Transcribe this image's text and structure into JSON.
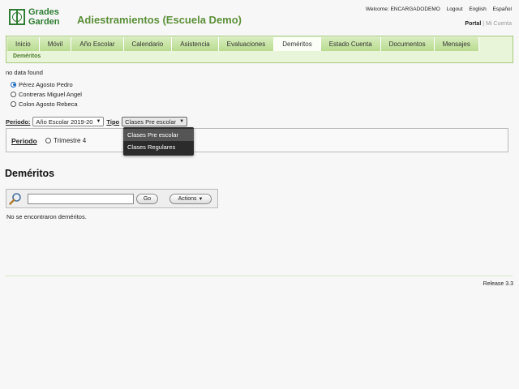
{
  "logo": {
    "line1": "Grades",
    "line2": "Garden"
  },
  "app_title": "Adiestramientos (Escuela Demo)",
  "top_links": {
    "welcome": "Welcome: ENCARGADODEMO",
    "logout": "Logout",
    "english": "English",
    "espanol": "Español"
  },
  "portal_links": {
    "portal": "Portal",
    "separator": "|",
    "mi_cuenta": "Mi Cuenta"
  },
  "nav": {
    "tabs": [
      "Inicio",
      "Móvil",
      "Año Escolar",
      "Calendario",
      "Asistencia",
      "Evaluaciones",
      "Deméritos",
      "Estado Cuenta",
      "Documentos",
      "Mensajes"
    ],
    "active": "Deméritos",
    "subnav": "Deméritos"
  },
  "no_data": "no data found",
  "students": [
    {
      "name": "Pérez Agosto Pedro",
      "selected": true
    },
    {
      "name": "Contreras Miguel Angel",
      "selected": false
    },
    {
      "name": "Colon Agosto Rebeca",
      "selected": false
    }
  ],
  "filters": {
    "periodo_label": "Periodo:",
    "periodo_value": "Año Escolar 2019-20",
    "tipo_label": "Tipo",
    "tipo_value": "Clases Pre escolar"
  },
  "period_box": {
    "label": "Periodo",
    "option": "Trimestre 4"
  },
  "tipo_dropdown": {
    "options": [
      "Clases Pre escolar",
      "Clases Regulares"
    ],
    "highlighted": "Clases Pre escolar"
  },
  "demeritos": {
    "title": "Deméritos",
    "go_label": "Go",
    "actions_label": "Actions",
    "no_results": "No se encontraron deméritos."
  },
  "footer": {
    "release": "Release 3.3"
  }
}
